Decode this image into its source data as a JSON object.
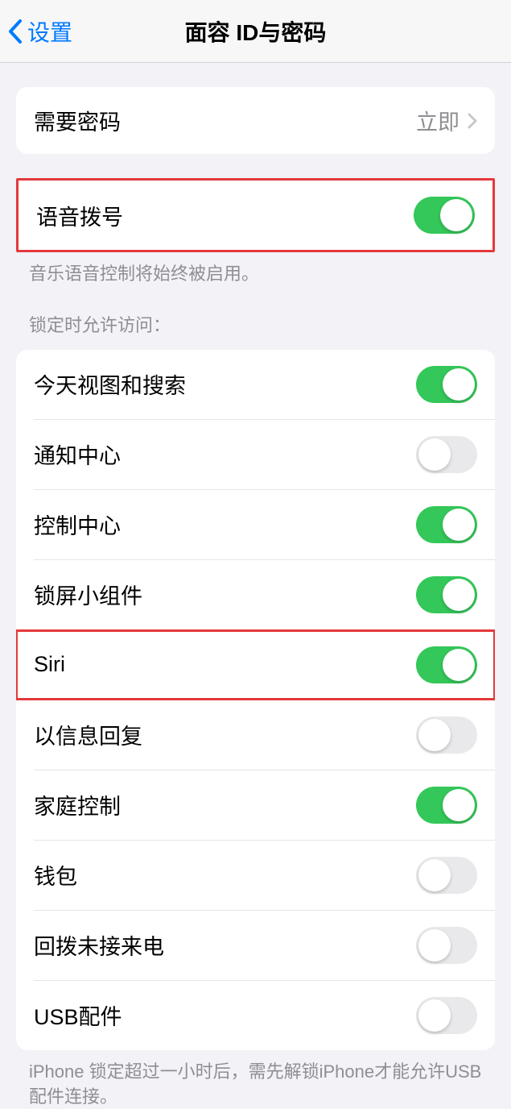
{
  "nav": {
    "back_label": "设置",
    "title": "面容 ID与密码"
  },
  "require_passcode": {
    "label": "需要密码",
    "value": "立即"
  },
  "voice_dial": {
    "label": "语音拨号",
    "on": true,
    "footer": "音乐语音控制将始终被启用。"
  },
  "lock_access": {
    "header": "锁定时允许访问：",
    "items": [
      {
        "label": "今天视图和搜索",
        "on": true,
        "highlighted": false
      },
      {
        "label": "通知中心",
        "on": false,
        "highlighted": false
      },
      {
        "label": "控制中心",
        "on": true,
        "highlighted": false
      },
      {
        "label": "锁屏小组件",
        "on": true,
        "highlighted": false
      },
      {
        "label": "Siri",
        "on": true,
        "highlighted": true
      },
      {
        "label": "以信息回复",
        "on": false,
        "highlighted": false
      },
      {
        "label": "家庭控制",
        "on": true,
        "highlighted": false
      },
      {
        "label": "钱包",
        "on": false,
        "highlighted": false
      },
      {
        "label": "回拨未接来电",
        "on": false,
        "highlighted": false
      },
      {
        "label": "USB配件",
        "on": false,
        "highlighted": false
      }
    ],
    "footer": "iPhone 锁定超过一小时后，需先解锁iPhone才能允许USB 配件连接。"
  }
}
